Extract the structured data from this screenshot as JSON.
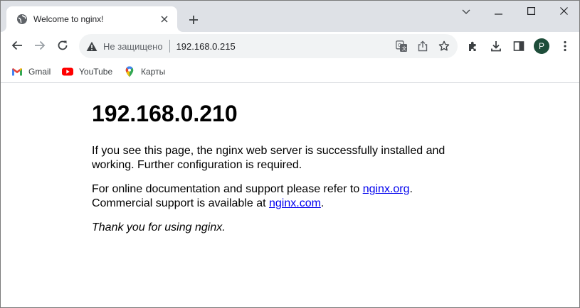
{
  "browser": {
    "tab": {
      "title": "Welcome to nginx!",
      "favicon": "globe-icon"
    },
    "new_tab_label": "+",
    "omnibox": {
      "security_label": "Не защищено",
      "url": "192.168.0.215"
    },
    "profile_initial": "P",
    "colors": {
      "tabstrip_bg": "#dee1e6",
      "avatar_bg": "#1e4d3a",
      "link": "#0000ee"
    }
  },
  "bookmarks": [
    {
      "label": "Gmail",
      "icon": "gmail-icon"
    },
    {
      "label": "YouTube",
      "icon": "youtube-icon"
    },
    {
      "label": "Карты",
      "icon": "maps-icon"
    }
  ],
  "page": {
    "heading": "192.168.0.210",
    "para1": "If you see this page, the nginx web server is successfully installed and working. Further configuration is required.",
    "para2_prefix": "For online documentation and support please refer to ",
    "link_org": "nginx.org",
    "para2_mid": ".\nCommercial support is available at ",
    "para2_mid_text": "Commercial support is available at ",
    "link_com": "nginx.com",
    "period": ".",
    "para3": "Thank you for using nginx."
  }
}
